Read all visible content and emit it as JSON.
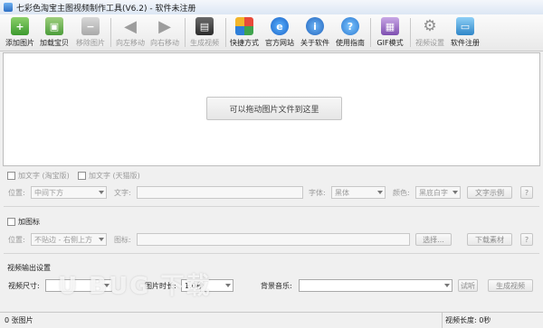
{
  "window": {
    "title": "七彩色淘宝主图视频制作工具(V6.2) - 软件未注册"
  },
  "toolbar": {
    "add_image": "添加图片",
    "add_product": "加载宝贝",
    "remove_image": "移除图片",
    "move_left": "向左移动",
    "move_right": "向右移动",
    "generate_video": "生成视频",
    "shortcut": "快捷方式",
    "website": "官方网站",
    "about": "关于软件",
    "guide": "使用指南",
    "gif_mode": "GIF模式",
    "video_settings": "视频设置",
    "register": "软件注册"
  },
  "dropzone": {
    "hint": "可以拖动图片文件到这里"
  },
  "text_section": {
    "taobao_checkbox": "加文字 (淘宝版)",
    "tmall_checkbox": "加文字 (天猫版)",
    "position_label": "位置:",
    "position_value": "中间下方",
    "text_label": "文字:",
    "font_label": "字体:",
    "font_value": "黑体",
    "color_label": "颜色:",
    "color_value": "黑底白字",
    "preview_button": "文字示例",
    "help_button": "?"
  },
  "logo_section": {
    "checkbox": "加图标",
    "position_label": "位置:",
    "position_value": "不贴边 - 右侧上方",
    "image_label": "图标:",
    "browse_button": "选择...",
    "download_button": "下载素材",
    "help_button": "?"
  },
  "output_section": {
    "heading": "视频输出设置",
    "size_label": "视频尺寸:",
    "size_value": "",
    "duration_label": "图片时长:",
    "duration_value": "1.0秒",
    "music_label": "背景音乐:",
    "music_value": "",
    "listen_button": "试听",
    "generate_button": "生成视频",
    "help_button": "?"
  },
  "status": {
    "image_count": "0 张图片",
    "video_length": "视频长度: 0秒"
  },
  "watermark": "U BUG 下载"
}
